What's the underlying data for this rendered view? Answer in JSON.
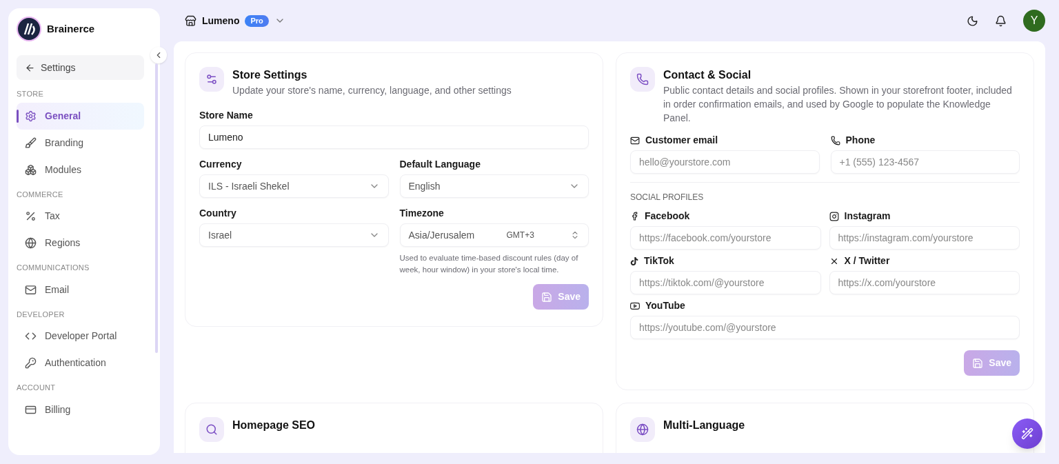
{
  "brand": {
    "name": "Brainerce"
  },
  "sidebar": {
    "back": "Settings",
    "sections": [
      {
        "title": "STORE",
        "items": [
          {
            "label": "General",
            "selected": true
          },
          {
            "label": "Branding",
            "selected": false
          },
          {
            "label": "Modules",
            "selected": false
          }
        ]
      },
      {
        "title": "COMMERCE",
        "items": [
          {
            "label": "Tax",
            "selected": false
          },
          {
            "label": "Regions",
            "selected": false
          }
        ]
      },
      {
        "title": "COMMUNICATIONS",
        "items": [
          {
            "label": "Email",
            "selected": false
          }
        ]
      },
      {
        "title": "DEVELOPER",
        "items": [
          {
            "label": "Developer Portal",
            "selected": false
          },
          {
            "label": "Authentication",
            "selected": false
          }
        ]
      },
      {
        "title": "ACCOUNT",
        "items": [
          {
            "label": "Billing",
            "selected": false
          }
        ]
      }
    ]
  },
  "topbar": {
    "store": "Lumeno",
    "badge": "Pro",
    "avatar": "Y"
  },
  "store_settings": {
    "title": "Store Settings",
    "subtitle": "Update your store's name, currency, language, and other settings",
    "fields": [
      {
        "kind": "text",
        "label": "Store Name",
        "value": "Lumeno"
      },
      {
        "kind": "select",
        "label": "Currency",
        "value": "ILS - Israeli Shekel"
      },
      {
        "kind": "select",
        "label": "Default Language",
        "value": "English"
      },
      {
        "kind": "select",
        "label": "Country",
        "value": "Israel"
      },
      {
        "kind": "timezone",
        "label": "Timezone",
        "value": "Asia/Jerusalem",
        "offset": "GMT+3",
        "help": "Used to evaluate time-based discount rules (day of week, hour window) in your store's local time."
      }
    ],
    "save": "Save"
  },
  "contact_social": {
    "title": "Contact & Social",
    "subtitle": "Public contact details and social profiles. Shown in your storefront footer, included in order confirmation emails, and used by Google to populate the Knowledge Panel.",
    "contact": [
      {
        "label": "Customer email",
        "placeholder": "hello@yourstore.com"
      },
      {
        "label": "Phone",
        "placeholder": "+1 (555) 123-4567"
      }
    ],
    "social_heading": "SOCIAL PROFILES",
    "social": [
      {
        "label": "Facebook",
        "placeholder": "https://facebook.com/yourstore"
      },
      {
        "label": "Instagram",
        "placeholder": "https://instagram.com/yourstore"
      },
      {
        "label": "TikTok",
        "placeholder": "https://tiktok.com/@yourstore"
      },
      {
        "label": "X / Twitter",
        "placeholder": "https://x.com/yourstore"
      },
      {
        "label": "YouTube",
        "placeholder": "https://youtube.com/@yourstore"
      }
    ],
    "save": "Save"
  },
  "lower_cards": [
    {
      "title": "Homepage SEO"
    },
    {
      "title": "Multi-Language"
    }
  ]
}
